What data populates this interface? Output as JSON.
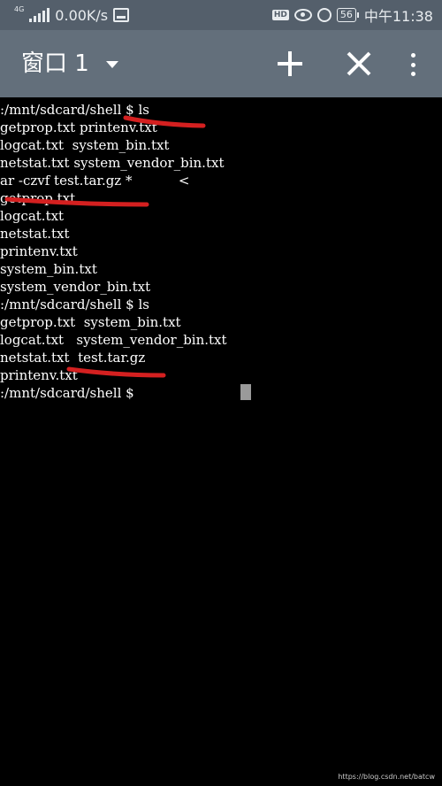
{
  "status_bar": {
    "network_tag": "4G",
    "speed": "0.00K/s",
    "hd": "HD",
    "battery": "56",
    "time": "中午11:38"
  },
  "app_bar": {
    "title": "窗口 1",
    "icons": [
      "dropdown-arrow-icon",
      "plus-icon",
      "close-icon",
      "more-vert-icon"
    ]
  },
  "terminal": {
    "lines": [
      ":/mnt/sdcard/shell $ ls",
      "getprop.txt printenv.txt",
      "logcat.txt  system_bin.txt",
      "netstat.txt system_vendor_bin.txt",
      "ar -czvf test.tar.gz *           <",
      "getprop.txt",
      "logcat.txt",
      "netstat.txt",
      "printenv.txt",
      "system_bin.txt",
      "system_vendor_bin.txt",
      ":/mnt/sdcard/shell $ ls",
      "getprop.txt  system_bin.txt",
      "logcat.txt   system_vendor_bin.txt",
      "netstat.txt  test.tar.gz",
      "printenv.txt",
      ":/mnt/sdcard/shell $"
    ],
    "annotation_color": "#d42020"
  },
  "watermark": "https://blog.csdn.net/batcw"
}
